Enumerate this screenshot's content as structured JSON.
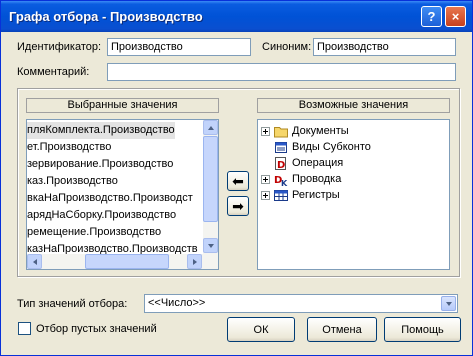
{
  "window": {
    "title": "Графа отбора - Производство",
    "help_button": "?",
    "close_button": "×"
  },
  "form": {
    "identifier_label": "Идентификатор:",
    "identifier_value": "Производство",
    "synonym_label": "Синоним:",
    "synonym_value": "Производство",
    "comment_label": "Комментарий:",
    "comment_value": ""
  },
  "selected_panel": {
    "title": "Выбранные значения",
    "items": [
      "пляКомплекта.Производство",
      "ет.Производство",
      "зервирование.Производство",
      "каз.Производство",
      "вкаНаПроизводство.Производст",
      "арядНаСборку.Производство",
      "ремещение.Производство",
      "казНаПроизводство.Производств"
    ],
    "selected_index": 0
  },
  "possible_panel": {
    "title": "Возможные значения",
    "items": [
      {
        "label": "Документы",
        "icon": "folder-icon",
        "expandable": true
      },
      {
        "label": "Виды Субконто",
        "icon": "subconto-types-icon",
        "expandable": false
      },
      {
        "label": "Операция",
        "icon": "operation-icon",
        "expandable": false
      },
      {
        "label": "Проводка",
        "icon": "posting-icon",
        "expandable": true
      },
      {
        "label": "Регистры",
        "icon": "registers-icon",
        "expandable": true
      }
    ]
  },
  "move_buttons": {
    "add": "⬅",
    "remove": "➡"
  },
  "filter_type": {
    "label": "Тип значений отбора:",
    "value": "<<Число>>"
  },
  "empty_filter": {
    "label": "Отбор пустых значений",
    "checked": false
  },
  "buttons": {
    "ok": "ОК",
    "cancel": "Отмена",
    "help": "Помощь"
  },
  "colors": {
    "titlebar": "#0052d6",
    "dialog_bg": "#ece9d8",
    "field_border": "#7f9db9"
  }
}
